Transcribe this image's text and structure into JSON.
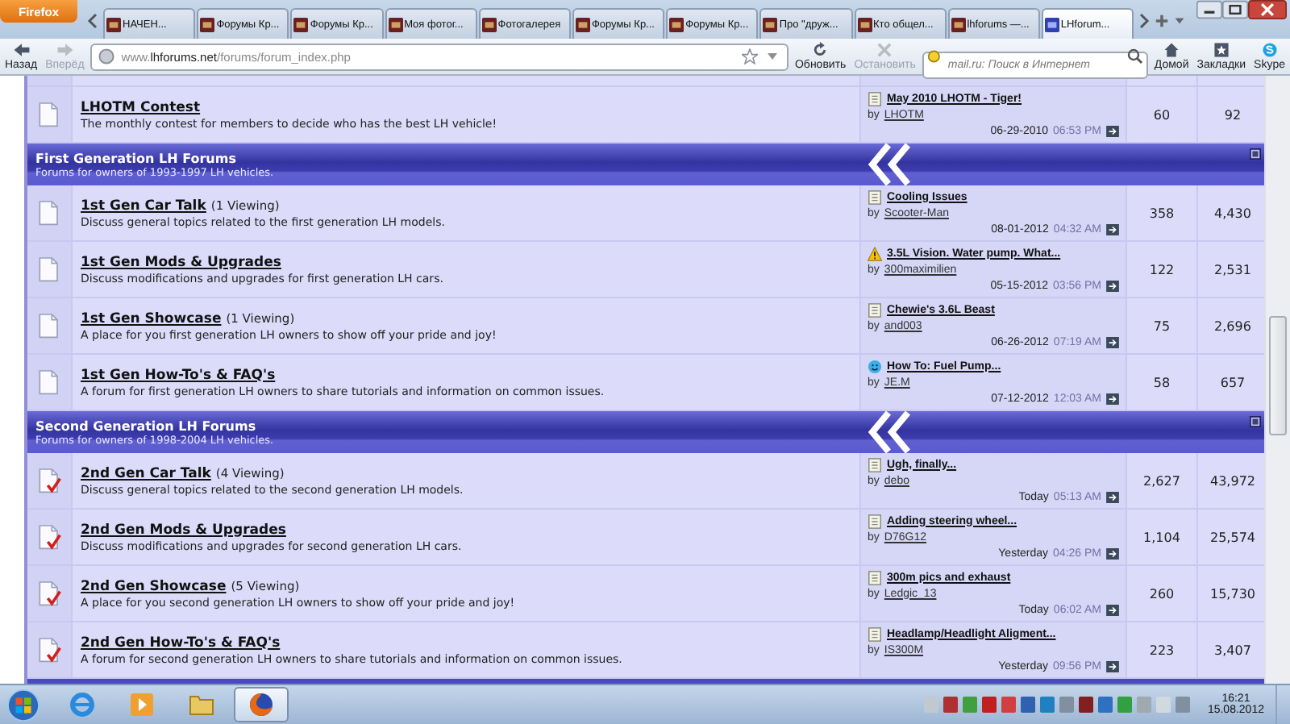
{
  "browser": {
    "menu_button": "Firefox",
    "tabs": [
      {
        "label": "НАЧЕН...",
        "selected": false
      },
      {
        "label": "Форумы Кр...",
        "selected": false
      },
      {
        "label": "Форумы Кр...",
        "selected": false
      },
      {
        "label": "Моя фотог...",
        "selected": false
      },
      {
        "label": "Фотогалерея",
        "selected": false
      },
      {
        "label": "Форумы Кр...",
        "selected": false
      },
      {
        "label": "Форумы Кр...",
        "selected": false
      },
      {
        "label": "Про \"друж...",
        "selected": false
      },
      {
        "label": "Кто общел...",
        "selected": false
      },
      {
        "label": "lhforums —...",
        "selected": false
      },
      {
        "label": "LHforum...",
        "selected": true
      }
    ]
  },
  "toolbar": {
    "buttons_left": [
      {
        "kind": "back",
        "label": "Назад",
        "disabled": false
      },
      {
        "kind": "forward",
        "label": "Вперёд",
        "disabled": true
      }
    ],
    "url": "www.**lhforums.net**/forums/forum_index.php",
    "buttons_mid": [
      {
        "kind": "reload",
        "label": "Обновить",
        "disabled": false
      },
      {
        "kind": "stop",
        "label": "Остановить",
        "disabled": true
      }
    ],
    "search_placeholder": "mail.ru: Поиск в Интернет",
    "buttons_right": [
      {
        "kind": "home",
        "label": "Домой",
        "disabled": false
      },
      {
        "kind": "bookmarks",
        "label": "Закладки",
        "disabled": false
      },
      {
        "kind": "skype",
        "label": "Skype",
        "disabled": false
      }
    ]
  },
  "top_rows": [
    {
      "title": "LHOTM Contest",
      "description": "The monthly contest for members to decide who has the best LH vehicle!",
      "new": false,
      "last_post": {
        "kind": "doc",
        "title": "May 2010 LHOTM - Tiger!",
        "by": "by",
        "author": "LHOTM",
        "date": "06-29-2010",
        "time": "06:53 PM"
      },
      "threads": "60",
      "posts": "92"
    }
  ],
  "sections": [
    {
      "title": "First Generation LH Forums",
      "subtitle": "Forums for owners of 1993-1997 LH vehicles.",
      "forums": [
        {
          "title": "1st Gen Car Talk",
          "viewing": "(1 Viewing)",
          "description": "Discuss general topics related to the first generation LH models.",
          "new": false,
          "last_post": {
            "kind": "doc",
            "title": "Cooling Issues",
            "by": "by",
            "author": "Scooter-Man",
            "date": "08-01-2012",
            "time": "04:32 AM"
          },
          "threads": "358",
          "posts": "4,430"
        },
        {
          "title": "1st Gen Mods & Upgrades",
          "description": "Discuss modifications and upgrades for first generation LH cars.",
          "new": false,
          "last_post": {
            "kind": "warning",
            "title": "3.5L Vision. Water pump. What...",
            "by": "by",
            "author": "300maximilien",
            "date": "05-15-2012",
            "time": "03:56 PM"
          },
          "threads": "122",
          "posts": "2,531"
        },
        {
          "title": "1st Gen Showcase",
          "viewing": "(1 Viewing)",
          "description": "A place for you first generation LH owners to show off your pride and joy!",
          "new": false,
          "last_post": {
            "kind": "doc",
            "title": "Chewie's 3.6L Beast",
            "by": "by",
            "author": "and003",
            "date": "06-26-2012",
            "time": "07:19 AM"
          },
          "threads": "75",
          "posts": "2,696"
        },
        {
          "title": "1st Gen How-To's & FAQ's",
          "description": "A forum for first generation LH owners to share tutorials and information on common issues.",
          "new": false,
          "last_post": {
            "kind": "smile",
            "title": "How To: Fuel Pump...",
            "by": "by",
            "author": "JE.M",
            "date": "07-12-2012",
            "time": "12:03 AM"
          },
          "threads": "58",
          "posts": "657"
        }
      ]
    },
    {
      "title": "Second Generation LH Forums",
      "subtitle": "Forums for owners of 1998-2004 LH vehicles.",
      "forums": [
        {
          "title": "2nd Gen Car Talk",
          "viewing": "(4 Viewing)",
          "description": "Discuss general topics related to the second generation LH models.",
          "new": true,
          "last_post": {
            "kind": "doc",
            "title": "Ugh, finally...",
            "by": "by",
            "author": "debo",
            "date": "Today",
            "time": "05:13 AM"
          },
          "threads": "2,627",
          "posts": "43,972"
        },
        {
          "title": "2nd Gen Mods & Upgrades",
          "description": "Discuss modifications and upgrades for second generation LH cars.",
          "new": true,
          "last_post": {
            "kind": "doc",
            "title": "Adding steering wheel...",
            "by": "by",
            "author": "D76G12",
            "date": "Yesterday",
            "time": "04:26 PM"
          },
          "threads": "1,104",
          "posts": "25,574"
        },
        {
          "title": "2nd Gen Showcase",
          "viewing": "(5 Viewing)",
          "description": "A place for you second generation LH owners to show off your pride and joy!",
          "new": true,
          "last_post": {
            "kind": "doc",
            "title": "300m pics and exhaust",
            "by": "by",
            "author": "Ledgic_13",
            "date": "Today",
            "time": "06:02 AM"
          },
          "threads": "260",
          "posts": "15,730"
        },
        {
          "title": "2nd Gen How-To's & FAQ's",
          "description": "A forum for second generation LH owners to share tutorials and information on common issues.",
          "new": true,
          "last_post": {
            "kind": "doc",
            "title": "Headlamp/Headlight Aligment...",
            "by": "by",
            "author": "IS300M",
            "date": "Yesterday",
            "time": "09:56 PM"
          },
          "threads": "223",
          "posts": "3,407"
        }
      ]
    }
  ],
  "taskbar": {
    "apps": [
      {
        "kind": "ie",
        "selected": false
      },
      {
        "kind": "media",
        "selected": false
      },
      {
        "kind": "folder",
        "selected": false
      },
      {
        "kind": "firefox",
        "selected": true
      }
    ],
    "time": "16:21",
    "date": "15.08.2012"
  }
}
